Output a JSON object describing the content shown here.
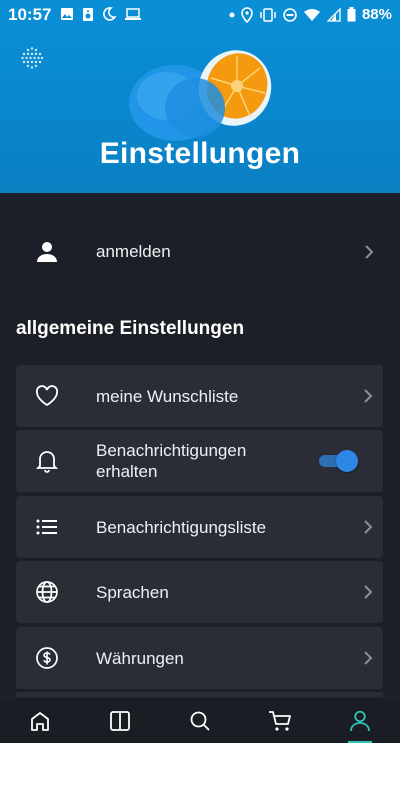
{
  "status_bar": {
    "time": "10:57",
    "battery": "88%",
    "left_icons": [
      "image-icon",
      "speaker-icon",
      "moon-icon",
      "laptop-icon"
    ],
    "right_icons": [
      "dot-icon",
      "location-icon",
      "vibrate-icon",
      "dnd-icon",
      "wifi-icon",
      "signal-icon",
      "battery-icon"
    ]
  },
  "header": {
    "title": "Einstellungen",
    "logo_icon": "dots-logo-icon"
  },
  "login": {
    "label": "anmelden",
    "icon": "person-icon"
  },
  "general": {
    "section_title": "allgemeine Einstellungen",
    "items": [
      {
        "label": "meine Wunschliste",
        "icon": "heart-icon",
        "control": "chevron"
      },
      {
        "label": "Benachrichtigungen erhalten",
        "icon": "bell-icon",
        "control": "toggle",
        "toggle_on": true
      },
      {
        "label": "Benachrichtigungsliste",
        "icon": "list-icon",
        "control": "chevron"
      },
      {
        "label": "Sprachen",
        "icon": "globe-icon",
        "control": "chevron"
      },
      {
        "label": "Währungen",
        "icon": "dollar-icon",
        "control": "chevron"
      }
    ]
  },
  "bottom_nav": {
    "items": [
      {
        "name": "home",
        "icon": "home-icon"
      },
      {
        "name": "categories",
        "icon": "columns-icon"
      },
      {
        "name": "search",
        "icon": "search-icon"
      },
      {
        "name": "cart",
        "icon": "cart-icon"
      },
      {
        "name": "account",
        "icon": "person-outline-icon",
        "active": true
      }
    ]
  },
  "colors": {
    "background": "#1c1f27",
    "card": "#2a2d36",
    "header_blue": "#0a8fd6",
    "accent_teal": "#2ec4b6",
    "toggle_blue": "#2e86e6"
  }
}
